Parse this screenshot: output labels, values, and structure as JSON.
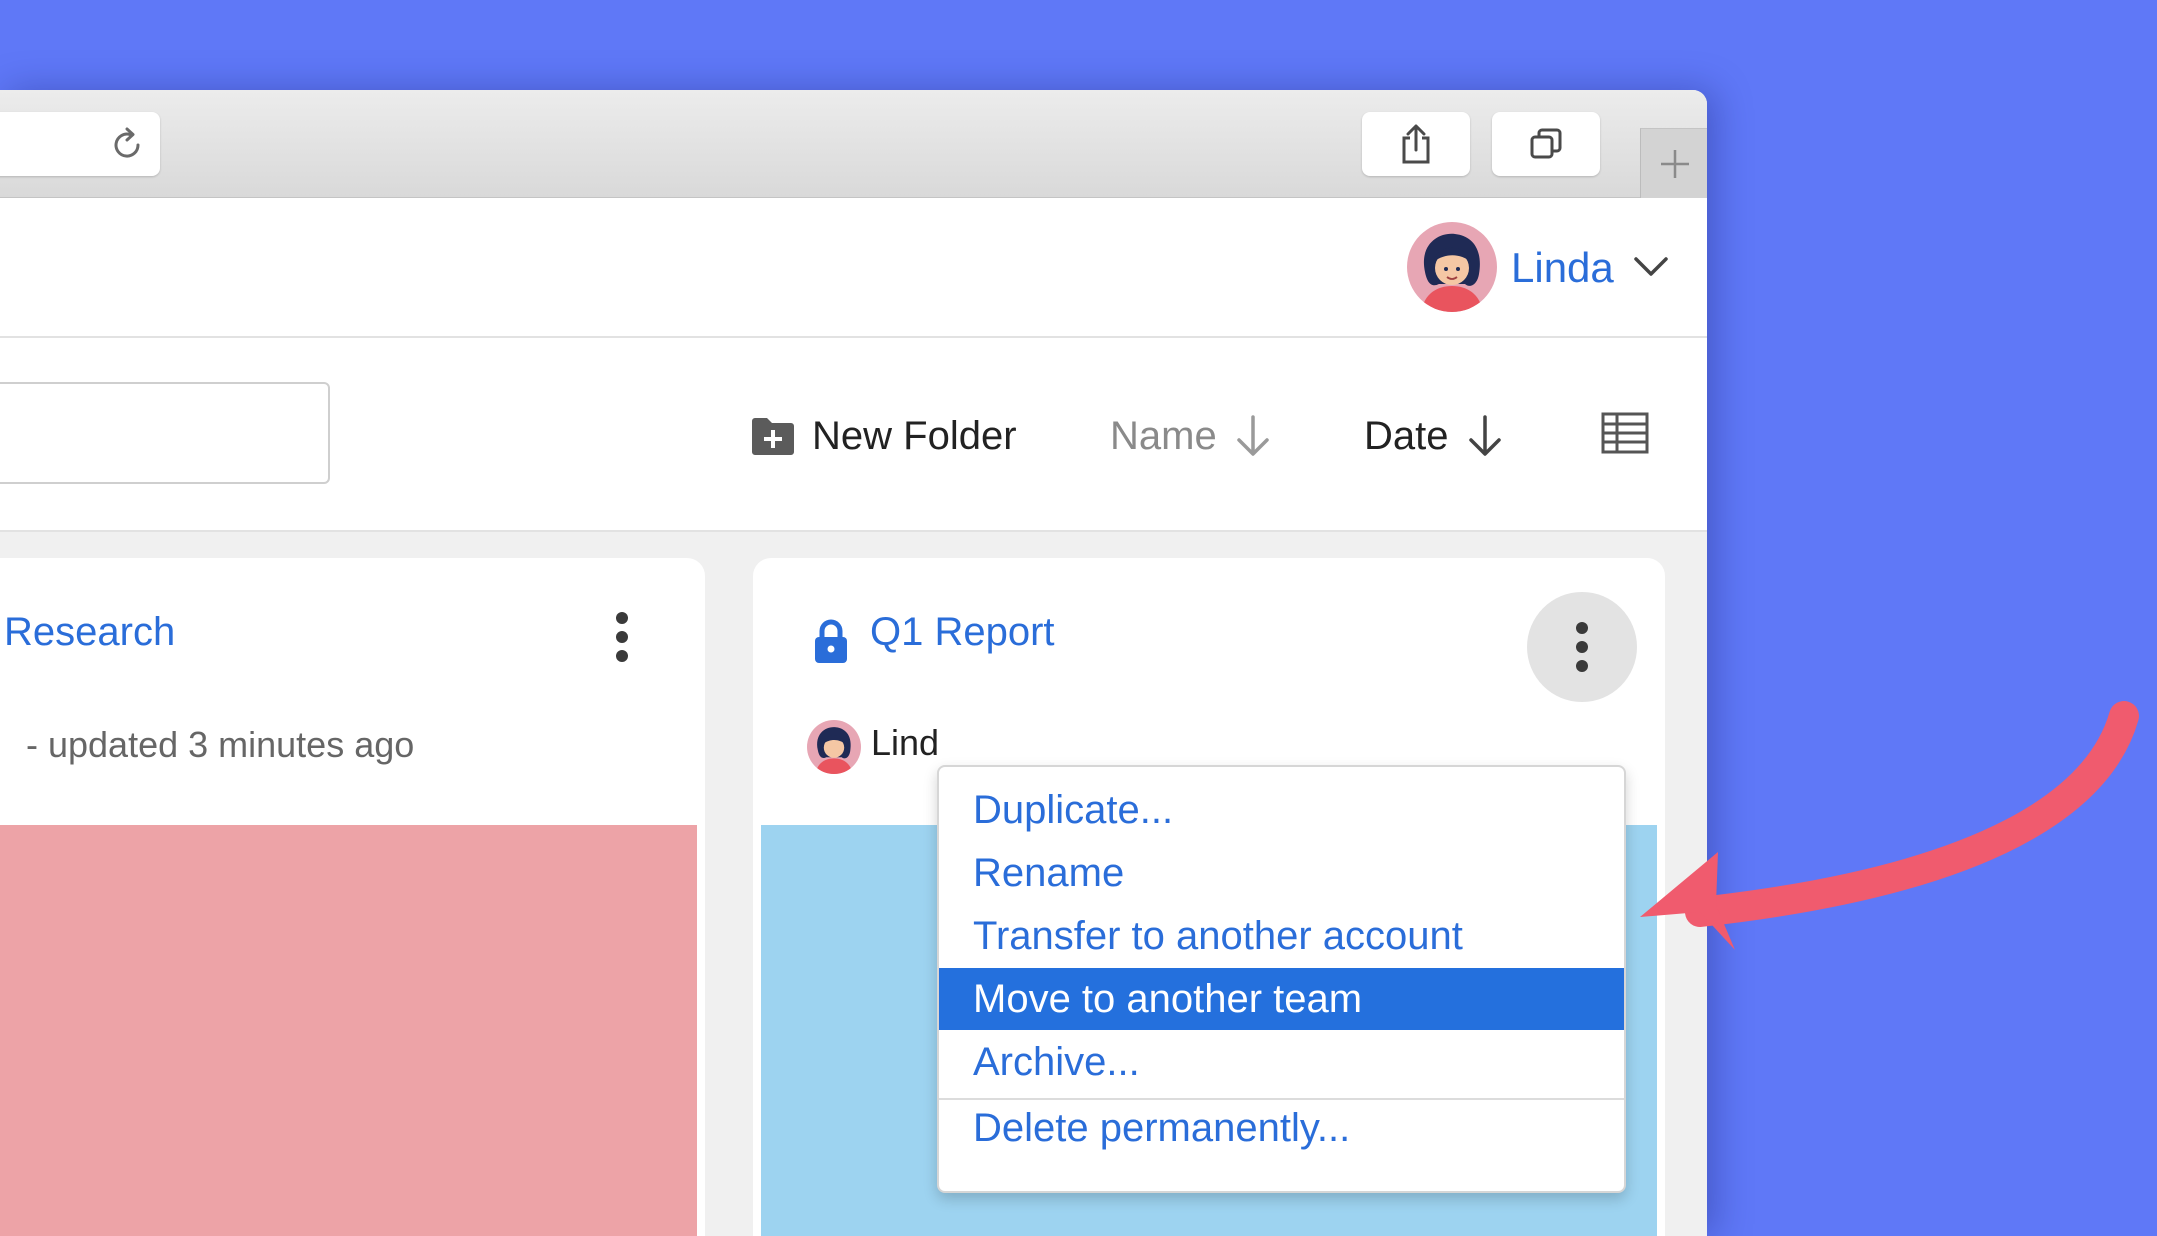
{
  "colors": {
    "background": "#5f78f7",
    "accent": "#2a6dd9",
    "highlight": "#2470dd",
    "arrow": "#f05b6e",
    "thumb_research": "#eda3a7",
    "thumb_q1": "#9dd3f0"
  },
  "toolbar": {
    "reload_icon": "reload-icon",
    "share_icon": "share-icon",
    "tabs_icon": "tabs-overview-icon",
    "new_tab_icon": "plus-icon"
  },
  "header": {
    "user_name": "Linda"
  },
  "filters": {
    "new_folder_label": "New Folder",
    "sort_name_label": "Name",
    "sort_date_label": "Date",
    "view_toggle_icon": "table-view-icon"
  },
  "cards": [
    {
      "title": "Research",
      "meta": "- updated 3 minutes ago"
    },
    {
      "title": "Q1 Report",
      "owner": "Lind",
      "locked": true
    }
  ],
  "menu": {
    "items": [
      "Duplicate...",
      "Rename",
      "Transfer to another account",
      "Move to another team",
      "Archive...",
      "Delete permanently..."
    ],
    "active": "Move to another team"
  }
}
